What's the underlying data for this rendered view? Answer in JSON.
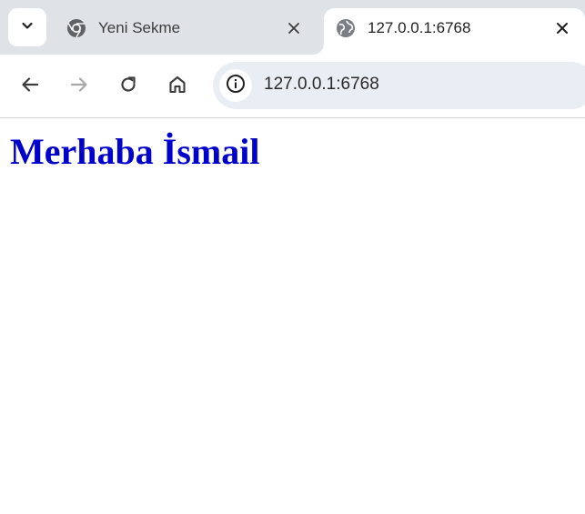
{
  "browser": {
    "tabs": [
      {
        "title": "Yeni Sekme",
        "favicon": "chrome-icon",
        "active": false
      },
      {
        "title": "127.0.0.1:6768",
        "favicon": "globe-icon",
        "active": true
      }
    ],
    "address_bar": {
      "url": "127.0.0.1:6768"
    },
    "toolbar_icons": [
      "back-arrow-icon",
      "forward-arrow-icon",
      "reload-icon",
      "home-icon",
      "info-icon"
    ]
  },
  "page": {
    "heading": "Merhaba İsmail",
    "heading_color": "#0000cd"
  }
}
